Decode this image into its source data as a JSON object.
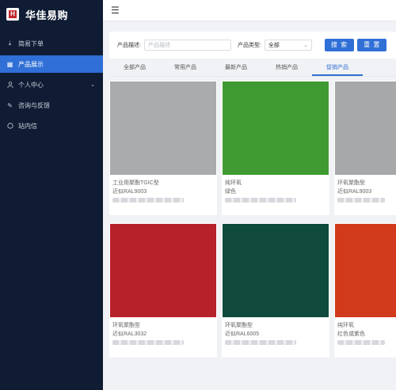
{
  "sidebar": {
    "brand": "华佳易购",
    "logo_text": "H",
    "items": [
      {
        "label": "简易下单",
        "icon": "download-icon",
        "active": false
      },
      {
        "label": "产品展示",
        "icon": "grid-icon",
        "active": true
      },
      {
        "label": "个人中心",
        "icon": "user-icon",
        "active": false
      },
      {
        "label": "咨询与反馈",
        "icon": "edit-icon",
        "active": false
      },
      {
        "label": "站内信",
        "icon": "message-icon",
        "active": false
      }
    ]
  },
  "filter": {
    "desc_label": "产品描述:",
    "desc_placeholder": "产品描述",
    "type_label": "产品类型:",
    "type_value": "全部",
    "search_label": "搜 索",
    "reset_label": "重 置"
  },
  "tabs": [
    "全部产品",
    "常用产品",
    "最新产品",
    "热销产品",
    "促销产品"
  ],
  "active_tab": 4,
  "products": [
    {
      "name": "工业用聚酯TGIC型",
      "color_name": "近似RAL9003",
      "swatch": "#a9abac"
    },
    {
      "name": "纯环氧",
      "color_name": "绿色",
      "swatch": "#3f9a31"
    },
    {
      "name": "环氧聚酯型",
      "color_name": "近似RAL9003",
      "swatch": "#a6a8a9"
    },
    {
      "name": "环氧聚酯型",
      "color_name": "近似RAL3032",
      "swatch": "#b7212a"
    },
    {
      "name": "环氧聚酯型",
      "color_name": "近似RAL6005",
      "swatch": "#0f4a3d"
    },
    {
      "name": "纯环氧",
      "color_name": "红色或紫色",
      "swatch": "#d23a1c"
    }
  ]
}
